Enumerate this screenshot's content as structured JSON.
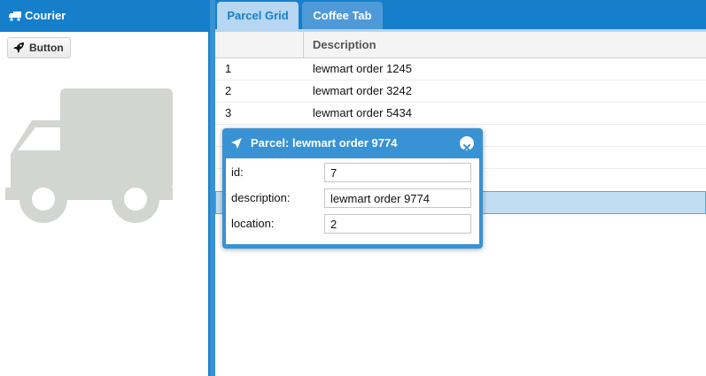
{
  "left_panel": {
    "title": "Courier",
    "button_label": "Button"
  },
  "tabs": [
    {
      "label": "Parcel Grid",
      "active": true
    },
    {
      "label": "Coffee Tab",
      "active": false
    }
  ],
  "grid": {
    "columns": [
      "",
      "Description"
    ],
    "rows": [
      {
        "id": "1",
        "description": "lewmart order 1245"
      },
      {
        "id": "2",
        "description": "lewmart order 3242"
      },
      {
        "id": "3",
        "description": "lewmart order 5434"
      },
      {
        "id": "",
        "description": ""
      },
      {
        "id": "",
        "description": ""
      },
      {
        "id": "",
        "description": ""
      }
    ]
  },
  "window": {
    "title": "Parcel: lewmart order 9774",
    "fields": [
      {
        "label": "id:",
        "value": "7"
      },
      {
        "label": "description:",
        "value": "lewmart order 9774"
      },
      {
        "label": "location:",
        "value": "2"
      }
    ]
  },
  "colors": {
    "accent": "#157fcc",
    "selected_row": "#c1ddf1",
    "truck_icon": "#d3d5d1"
  },
  "icons": {
    "header": "truck-icon",
    "button": "rocket-icon",
    "window": "paper-plane-icon",
    "close": "close-icon"
  }
}
